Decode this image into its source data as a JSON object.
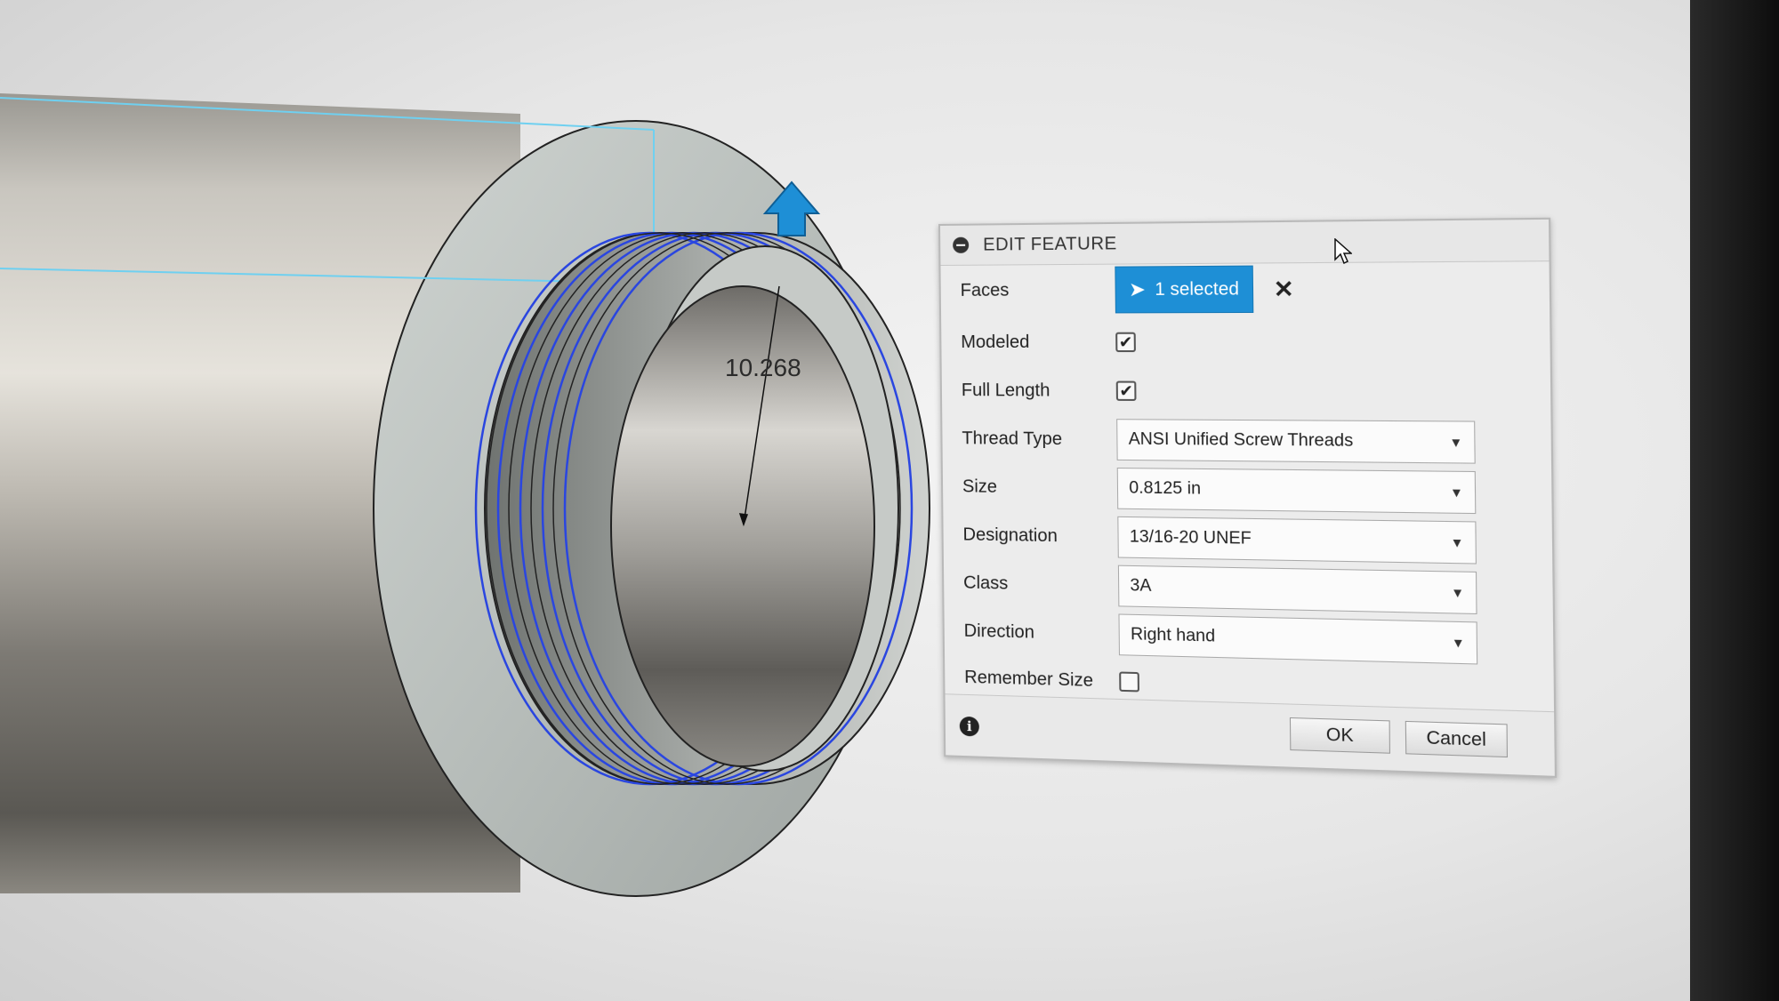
{
  "dialog": {
    "title": "EDIT FEATURE",
    "faces": {
      "label": "Faces",
      "selection": "1 selected"
    },
    "modeled": {
      "label": "Modeled",
      "checked": true
    },
    "full_length": {
      "label": "Full Length",
      "checked": true
    },
    "thread_type": {
      "label": "Thread Type",
      "value": "ANSI Unified Screw Threads"
    },
    "size": {
      "label": "Size",
      "value": "0.8125 in"
    },
    "designation": {
      "label": "Designation",
      "value": "13/16-20 UNEF"
    },
    "class": {
      "label": "Class",
      "value": "3A"
    },
    "direction": {
      "label": "Direction",
      "value": "Right hand"
    },
    "remember_size": {
      "label": "Remember Size",
      "checked": false
    },
    "ok_label": "OK",
    "cancel_label": "Cancel"
  },
  "viewport": {
    "dimension_value": "10.268"
  },
  "icons": {
    "collapse": "minus-circle-icon",
    "selection": "cursor-arrow-icon",
    "clear": "close-icon",
    "info": "info-icon",
    "manipulator": "up-arrow-icon"
  },
  "colors": {
    "accent": "#1e8fd6",
    "thread_lines": "#2a46e0",
    "highlight": "#6fd0f0"
  }
}
